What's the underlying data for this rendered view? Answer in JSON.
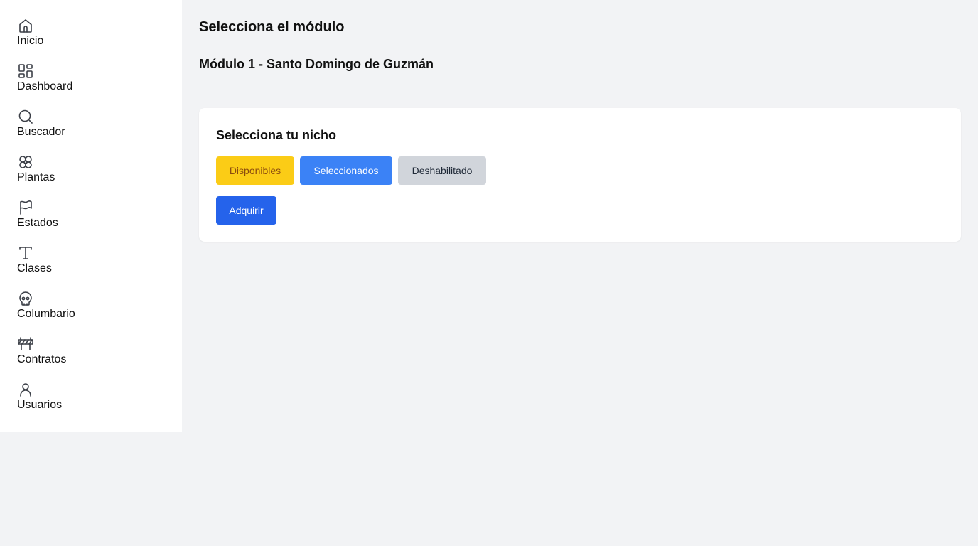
{
  "sidebar": {
    "items": [
      {
        "label": "Inicio",
        "icon": "home-icon"
      },
      {
        "label": "Dashboard",
        "icon": "dashboard-icon"
      },
      {
        "label": "Buscador",
        "icon": "search-icon"
      },
      {
        "label": "Plantas",
        "icon": "flower-icon"
      },
      {
        "label": "Estados",
        "icon": "flag-icon"
      },
      {
        "label": "Clases",
        "icon": "typography-icon"
      },
      {
        "label": "Columbario",
        "icon": "skull-icon"
      },
      {
        "label": "Contratos",
        "icon": "barrier-icon"
      },
      {
        "label": "Usuarios",
        "icon": "user-icon"
      }
    ]
  },
  "main": {
    "title": "Selecciona el módulo",
    "module_title": "Módulo 1 - Santo Domingo de Guzmán",
    "card": {
      "title": "Selecciona tu nicho",
      "legend": {
        "available": "Disponibles",
        "selected": "Seleccionados",
        "disabled": "Deshabilitado"
      },
      "acquire_label": "Adquirir"
    }
  },
  "colors": {
    "background": "#f2f3f5",
    "sidebar": "#ffffff",
    "available": "#fbcc16",
    "selected": "#3b82f6",
    "disabled": "#d1d5db",
    "primary": "#2563eb"
  }
}
